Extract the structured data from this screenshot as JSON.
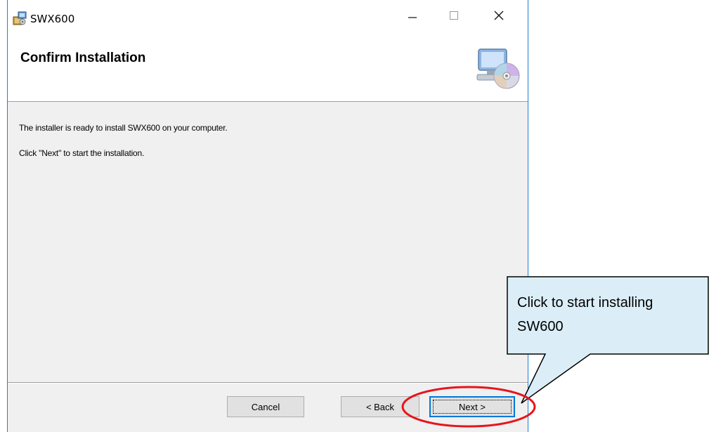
{
  "window": {
    "title": "SWX600",
    "controls": {
      "minimize": "minimize-icon",
      "maximize": "maximize-icon",
      "close": "close-icon"
    }
  },
  "banner": {
    "title": "Confirm Installation",
    "icon": "computer-cd-icon"
  },
  "content": {
    "line1": "The installer is ready to install SWX600 on your computer.",
    "line2": "Click \"Next\" to start the installation."
  },
  "buttons": {
    "cancel": "Cancel",
    "back": "< Back",
    "next": "Next >"
  },
  "annotation": {
    "callout_line1": "Click to start installing",
    "callout_line2": "SW600",
    "callout_fill": "#dbeef7",
    "highlight_color": "#e8141b"
  }
}
